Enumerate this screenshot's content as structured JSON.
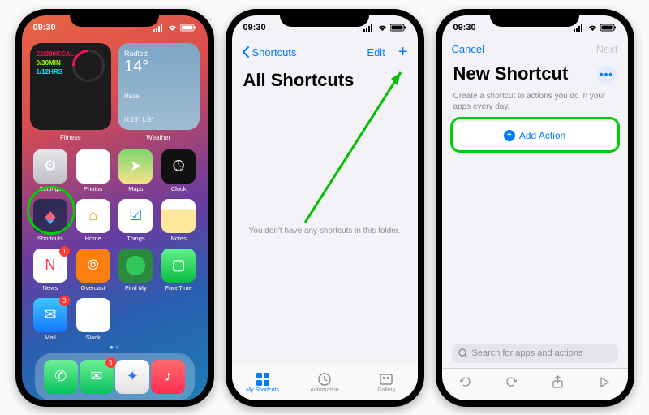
{
  "status": {
    "time": "09:30"
  },
  "home": {
    "fitness": {
      "widget_name": "Fitness",
      "kcal": "22/300KCAL",
      "move": "0/30MIN",
      "stand": "1/12HRS"
    },
    "weather": {
      "widget_name": "Weather",
      "location": "Radlett",
      "temp": "14°",
      "cond1": "Haze",
      "cond2": "H:19° L:9°"
    },
    "apps": {
      "settings": "Settings",
      "photos": "Photos",
      "maps": "Maps",
      "clock": "Clock",
      "shortcuts": "Shortcuts",
      "home_app": "Home",
      "things": "Things",
      "notes": "Notes",
      "news": "News",
      "overcast": "Overcast",
      "findmy": "Find My",
      "facetime": "FaceTime",
      "mail": "Mail",
      "slack": "Slack"
    },
    "badges": {
      "news": "1",
      "mail": "3",
      "messages": "5"
    }
  },
  "shortcuts_list": {
    "back": "Shortcuts",
    "edit": "Edit",
    "title": "All Shortcuts",
    "empty": "You don't have any shortcuts in this folder.",
    "tabs": {
      "my": "My Shortcuts",
      "automation": "Automation",
      "gallery": "Gallery"
    }
  },
  "new_shortcut": {
    "cancel": "Cancel",
    "next": "Next",
    "title": "New Shortcut",
    "subtitle": "Create a shortcut to actions you do in your apps every day.",
    "add_action": "Add Action",
    "search_placeholder": "Search for apps and actions"
  }
}
